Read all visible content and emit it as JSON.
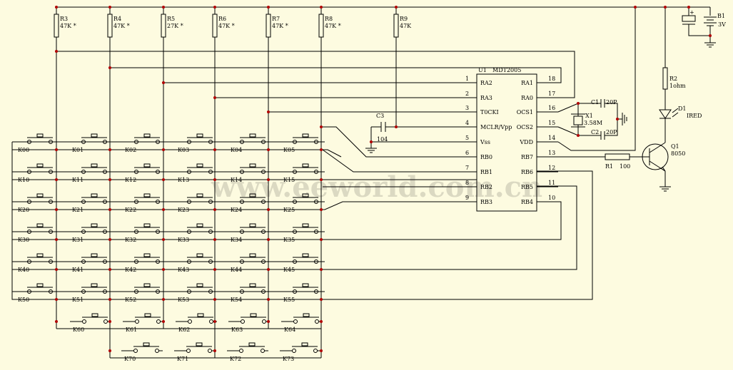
{
  "chip": {
    "ref": "U1",
    "part": "MDT2005",
    "left_pins": [
      {
        "num": "1",
        "name": "RA2"
      },
      {
        "num": "2",
        "name": "RA3"
      },
      {
        "num": "3",
        "name": "T0CKI"
      },
      {
        "num": "4",
        "name": "MCLR/Vpp"
      },
      {
        "num": "5",
        "name": "Vss"
      },
      {
        "num": "6",
        "name": "RB0"
      },
      {
        "num": "7",
        "name": "RB1"
      },
      {
        "num": "8",
        "name": "RB2"
      },
      {
        "num": "9",
        "name": "RB3"
      }
    ],
    "right_pins": [
      {
        "num": "18",
        "name": "RA1"
      },
      {
        "num": "17",
        "name": "RA0"
      },
      {
        "num": "16",
        "name": "OCS1"
      },
      {
        "num": "15",
        "name": "OCS2"
      },
      {
        "num": "14",
        "name": "VDD"
      },
      {
        "num": "13",
        "name": "RB7"
      },
      {
        "num": "12",
        "name": "RB6"
      },
      {
        "num": "11",
        "name": "RB5"
      },
      {
        "num": "10",
        "name": "RB4"
      }
    ]
  },
  "pullups": [
    {
      "ref": "R3",
      "value": "47K *"
    },
    {
      "ref": "R4",
      "value": "47K *"
    },
    {
      "ref": "R5",
      "value": "27K *"
    },
    {
      "ref": "R6",
      "value": "47K *"
    },
    {
      "ref": "R7",
      "value": "47K *"
    },
    {
      "ref": "R8",
      "value": "47K *"
    },
    {
      "ref": "R9",
      "value": "47K"
    }
  ],
  "parts": {
    "c3": {
      "ref": "C3",
      "value": "104"
    },
    "c1": {
      "ref": "C1",
      "value": "20P"
    },
    "c2": {
      "ref": "C2",
      "value": "20P"
    },
    "x1": {
      "ref": "X1",
      "value": "3.58M"
    },
    "b1": {
      "ref": "B1",
      "value": "3V",
      "plus": "+"
    },
    "r2": {
      "ref": "R2",
      "value": "1ohm"
    },
    "d1": {
      "ref": "D1",
      "value": "IRED"
    },
    "q1": {
      "ref": "Q1",
      "value": "8050"
    },
    "r1": {
      "ref": "R1",
      "value": "100"
    }
  },
  "keys": [
    [
      "K00",
      "K01",
      "K02",
      "K03",
      "K04",
      "K05"
    ],
    [
      "K10",
      "K11",
      "K12",
      "K13",
      "K14",
      "K15"
    ],
    [
      "K20",
      "K21",
      "K22",
      "K23",
      "K24",
      "K25"
    ],
    [
      "K30",
      "K31",
      "K32",
      "K33",
      "K34",
      "K35"
    ],
    [
      "K40",
      "K41",
      "K42",
      "K43",
      "K44",
      "K45"
    ],
    [
      "K50",
      "K51",
      "K52",
      "K53",
      "K54",
      "K55"
    ],
    [
      "K60",
      "K61",
      "K62",
      "K63",
      "K64"
    ],
    [
      "K70",
      "K71",
      "K72",
      "K73"
    ]
  ],
  "watermark": "www.eeworld.com.cn",
  "colors": {
    "background": "#fdfbe0",
    "wire": "#000000",
    "junction": "#b00000",
    "watermark": "#000000"
  }
}
